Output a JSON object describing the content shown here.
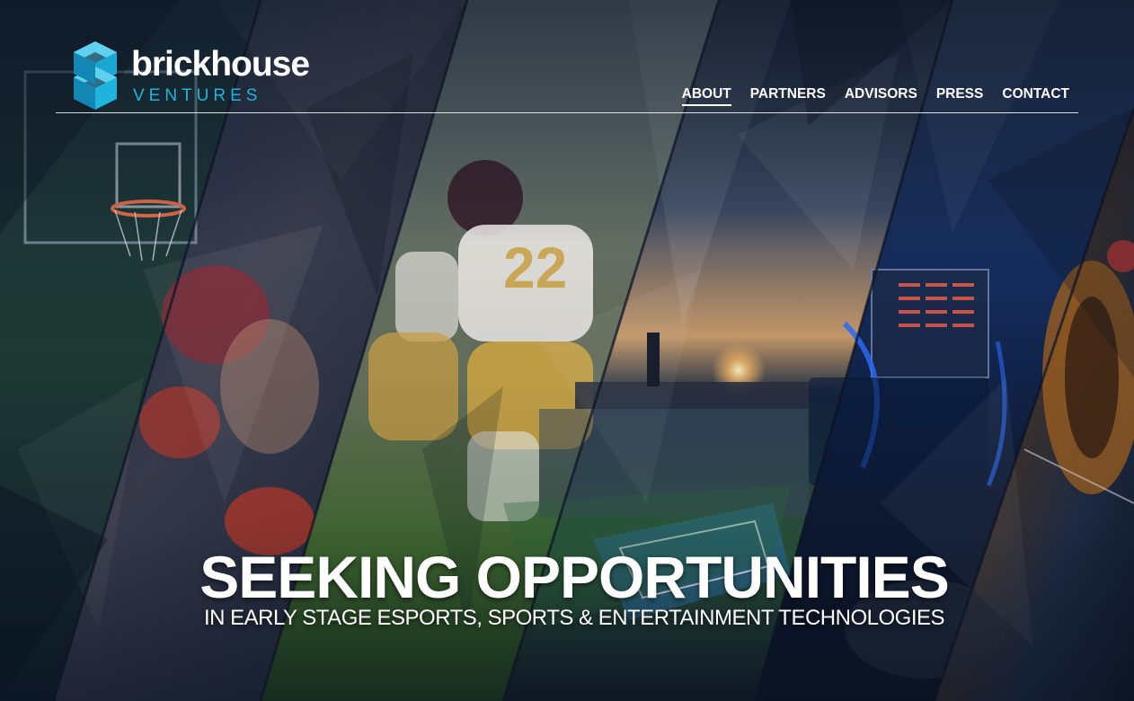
{
  "brand": {
    "name": "brickhouse",
    "tagline": "VENTURES",
    "accent_color": "#1fb4dc",
    "logo_icon": "hexagon-b-logo-icon"
  },
  "nav": {
    "items": [
      {
        "label": "ABOUT",
        "active": true
      },
      {
        "label": "PARTNERS",
        "active": false
      },
      {
        "label": "ADVISORS",
        "active": false
      },
      {
        "label": "PRESS",
        "active": false
      },
      {
        "label": "CONTACT",
        "active": false
      }
    ]
  },
  "hero": {
    "headline": "SEEKING OPPORTUNITIES",
    "subheadline": "IN EARLY STAGE ESPORTS, SPORTS & ENTERTAINMENT TECHNOLOGIES",
    "panels": [
      "basketball-hoop-photo",
      "boxing-photo",
      "american-football-photo",
      "tennis-stadium-photo",
      "esports-console-photo",
      "guitar-photo"
    ]
  }
}
